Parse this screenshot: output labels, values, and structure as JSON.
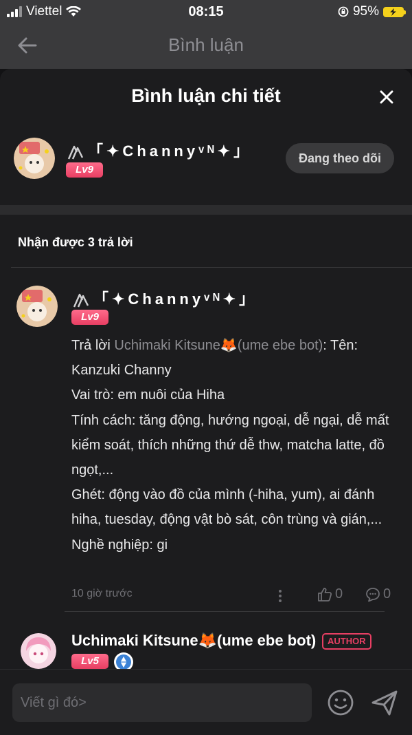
{
  "status": {
    "carrier": "Viettel",
    "time": "08:15",
    "battery": "95%"
  },
  "nav": {
    "title": "Bình luận"
  },
  "sheet": {
    "title": "Bình luận chi tiết"
  },
  "commenter": {
    "name": "「✦Channyᵛᴺ✦」",
    "level": "Lv9",
    "follow_label": "Đang theo dõi"
  },
  "replies": {
    "count_label": "Nhận được 3 trả lời"
  },
  "reply": {
    "name": "「✦Channyᵛᴺ✦」",
    "level": "Lv9",
    "prefix": "Trả lời ",
    "mention": "Uchimaki Kitsune🦊(ume ebe bot)",
    "lines": [
      ": Tên: Kanzuki Channy",
      "Vai trò: em nuôi của Hiha",
      "Tính cách: tăng động, hướng ngoại, dễ ngại, dễ mất kiểm soát, thích những thứ dễ thw, matcha latte, đồ ngọt,...",
      "Ghét: động vào đồ của mình (-hiha, yum), ai đánh hiha, tuesday, động vật bò sát, côn trùng và gián,...",
      "Nghề nghiệp: gi"
    ],
    "time": "10 giờ trước",
    "likes": "0",
    "comments": "0"
  },
  "author": {
    "name": "Uchimaki Kitsune🦊(ume ebe bot)",
    "badge": "AUTHOR",
    "level": "Lv5"
  },
  "input": {
    "placeholder": "Viết gì đó>"
  }
}
